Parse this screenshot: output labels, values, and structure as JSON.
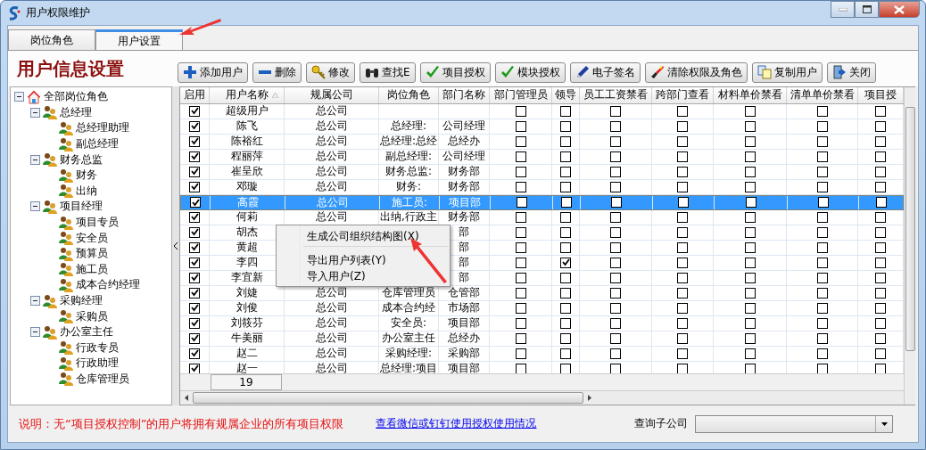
{
  "window": {
    "title": "用户权限维护"
  },
  "tabs": [
    {
      "label": "岗位角色",
      "selected": false
    },
    {
      "label": "用户设置",
      "selected": true
    }
  ],
  "heading": "用户信息设置",
  "toolbar": [
    "添加用户",
    "删除",
    "修改",
    "查找E",
    "项目授权",
    "模块授权",
    "电子签名",
    "清除权限及角色",
    "复制用户",
    "关闭"
  ],
  "tree": [
    {
      "label": "全部岗位角色",
      "expanded": true,
      "children": [
        {
          "label": "总经理",
          "expanded": true,
          "children": [
            {
              "label": "总经理助理"
            },
            {
              "label": "副总经理"
            }
          ]
        },
        {
          "label": "财务总监",
          "expanded": true,
          "children": [
            {
              "label": "财务"
            },
            {
              "label": "出纳"
            }
          ]
        },
        {
          "label": "项目经理",
          "expanded": true,
          "children": [
            {
              "label": "项目专员"
            },
            {
              "label": "安全员"
            },
            {
              "label": "预算员"
            },
            {
              "label": "施工员"
            },
            {
              "label": "成本合约经理"
            }
          ]
        },
        {
          "label": "采购经理",
          "expanded": true,
          "children": [
            {
              "label": "采购员"
            }
          ]
        },
        {
          "label": "办公室主任",
          "expanded": true,
          "children": [
            {
              "label": "行政专员"
            },
            {
              "label": "行政助理"
            },
            {
              "label": "仓库管理员"
            }
          ]
        }
      ]
    }
  ],
  "table": {
    "columns": [
      "启用",
      "用户名称",
      "规属公司",
      "岗位角色",
      "部门名称",
      "部门管理员",
      "领导",
      "员工工资禁看",
      "跨部门查看",
      "材料单价禁看",
      "清单单价禁看",
      "项目授"
    ],
    "rows": [
      {
        "enabled": true,
        "name": "超级用户",
        "company": "总公司",
        "selected": false,
        "flags": [
          false,
          false,
          false,
          false,
          false,
          false,
          false
        ]
      },
      {
        "enabled": true,
        "name": "陈飞",
        "company": "总公司",
        "role": "总经理:",
        "dept": "公司经理",
        "selected": false,
        "flags": [
          false,
          false,
          false,
          false,
          false,
          false,
          false
        ]
      },
      {
        "enabled": true,
        "name": "陈裕红",
        "company": "总公司",
        "role": "总经理:总经",
        "dept": "总经办",
        "selected": false,
        "flags": [
          false,
          false,
          false,
          false,
          false,
          false,
          false
        ]
      },
      {
        "enabled": true,
        "name": "程丽萍",
        "company": "总公司",
        "role": "副总经理:",
        "dept": "公司经理",
        "selected": false,
        "flags": [
          false,
          false,
          false,
          false,
          false,
          false,
          false
        ]
      },
      {
        "enabled": true,
        "name": "崔呈欣",
        "company": "总公司",
        "role": "财务总监:",
        "dept": "财务部",
        "selected": false,
        "flags": [
          false,
          false,
          false,
          false,
          false,
          false,
          false
        ]
      },
      {
        "enabled": true,
        "name": "邓璇",
        "company": "总公司",
        "role": "财务:",
        "dept": "财务部",
        "selected": false,
        "flags": [
          false,
          false,
          false,
          false,
          false,
          false,
          false
        ]
      },
      {
        "enabled": true,
        "name": "高霞",
        "company": "总公司",
        "role": "施工员:",
        "dept": "项目部",
        "selected": true,
        "flags": [
          false,
          false,
          false,
          false,
          false,
          false,
          false
        ]
      },
      {
        "enabled": true,
        "name": "何莉",
        "company": "总公司",
        "role": "出纳,行政主",
        "dept": "财务部",
        "selected": false,
        "flags": [
          false,
          false,
          false,
          false,
          false,
          false,
          false
        ]
      },
      {
        "enabled": true,
        "name": "胡杰",
        "dept": "部",
        "selected": false,
        "flags": [
          false,
          false,
          false,
          false,
          false,
          false,
          false
        ]
      },
      {
        "enabled": true,
        "name": "黄超",
        "dept": "部",
        "selected": false,
        "flags": [
          false,
          false,
          false,
          false,
          false,
          false,
          false
        ]
      },
      {
        "enabled": true,
        "name": "李四",
        "dept": "部",
        "selected": false,
        "flags": [
          false,
          true,
          false,
          false,
          false,
          false,
          false
        ]
      },
      {
        "enabled": true,
        "name": "李宜新",
        "dept": "部",
        "selected": false,
        "flags": [
          false,
          false,
          false,
          false,
          false,
          false,
          false
        ]
      },
      {
        "enabled": true,
        "name": "刘婕",
        "company": "总公司",
        "role": "仓库管理员",
        "dept": "仓管部",
        "selected": false,
        "flags": [
          false,
          false,
          false,
          false,
          false,
          false,
          false
        ]
      },
      {
        "enabled": true,
        "name": "刘俊",
        "company": "总公司",
        "role": "成本合约经",
        "dept": "市场部",
        "selected": false,
        "flags": [
          false,
          false,
          false,
          false,
          false,
          false,
          false
        ]
      },
      {
        "enabled": true,
        "name": "刘筱芬",
        "company": "总公司",
        "role": "安全员:",
        "dept": "项目部",
        "selected": false,
        "flags": [
          false,
          false,
          false,
          false,
          false,
          false,
          false
        ]
      },
      {
        "enabled": true,
        "name": "牛美丽",
        "company": "总公司",
        "role": "办公室主任",
        "dept": "总经办",
        "selected": false,
        "flags": [
          false,
          false,
          false,
          false,
          false,
          false,
          false
        ]
      },
      {
        "enabled": true,
        "name": "赵二",
        "company": "总公司",
        "role": "采购经理:",
        "dept": "采购部",
        "selected": false,
        "flags": [
          false,
          false,
          false,
          false,
          false,
          false,
          false
        ]
      },
      {
        "enabled": true,
        "name": "赵一",
        "company": "总公司",
        "role": "总经理:项目",
        "dept": "项目部",
        "selected": false,
        "flags": [
          false,
          false,
          false,
          false,
          false,
          false,
          false
        ]
      }
    ],
    "count": "19"
  },
  "context_menu": [
    {
      "label": "生成公司组织结构图(X)",
      "separator_after": true
    },
    {
      "label": "导出用户列表(Y)",
      "separator_after": false
    },
    {
      "label": "导入用户(Z)",
      "separator_after": false
    }
  ],
  "note": "说明：无“项目授权控制”的用户将拥有规属企业的所有项目权限",
  "link": "查看微信或钉钉使用授权使用情况",
  "subcompany": {
    "label": "查询子公司"
  }
}
